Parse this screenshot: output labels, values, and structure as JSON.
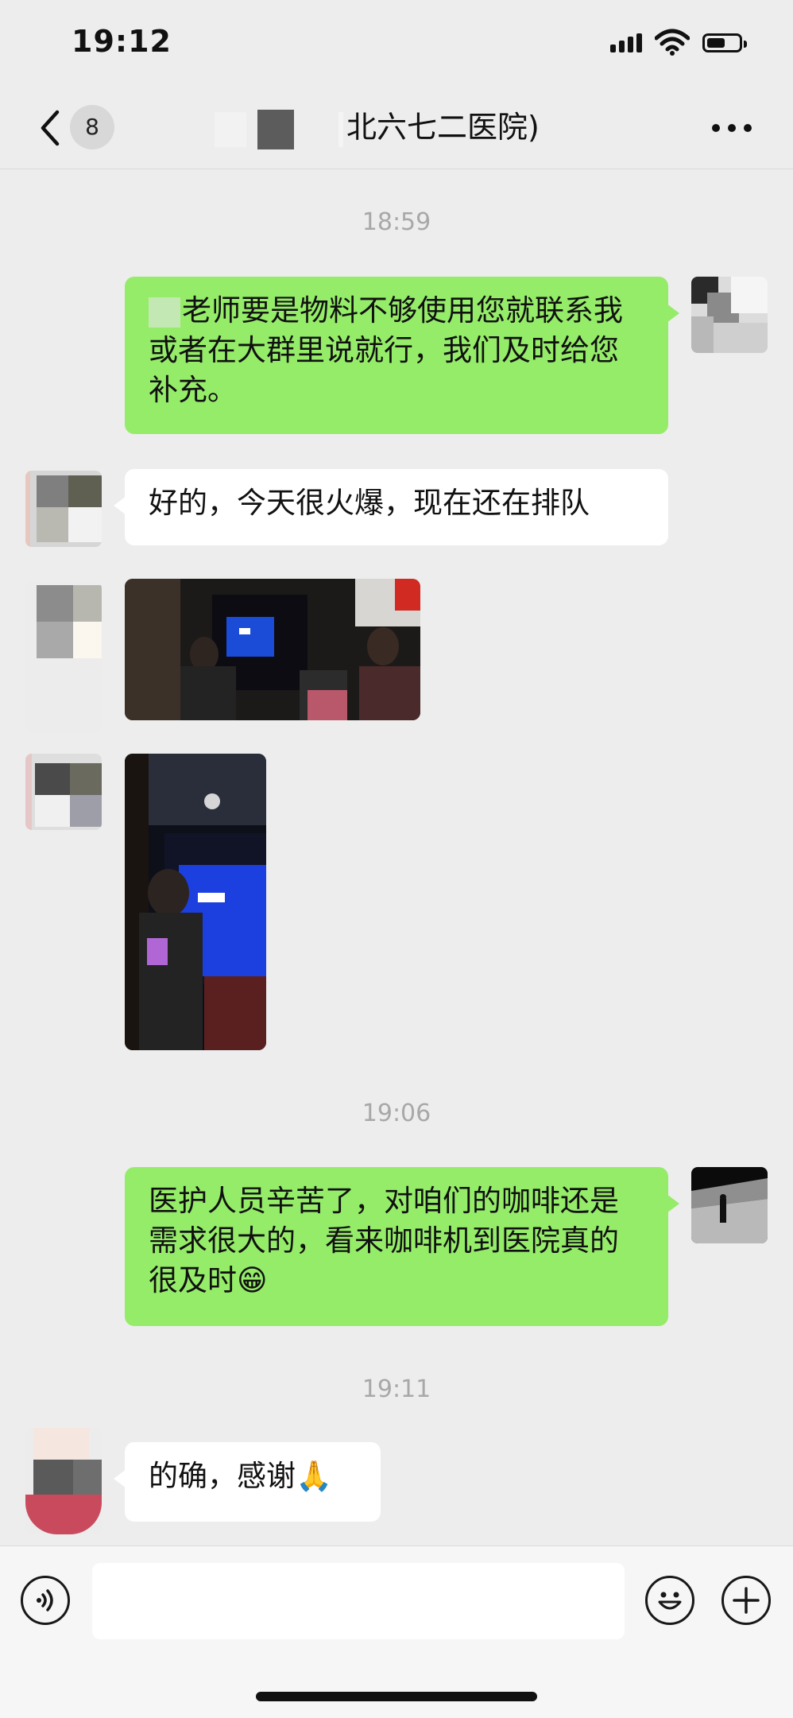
{
  "status_bar": {
    "time": "19:12"
  },
  "nav": {
    "unread_count": "8",
    "title": "北六七二医院)"
  },
  "messages": {
    "ts1": "18:59",
    "m1_text": "老师要是物料不够使用您就联系我或者在大群里说就行，我们及时给您补充。",
    "m2_text": "好的，今天很火爆，现在还在排队",
    "ts2": "19:06",
    "m3_text": "医护人员辛苦了，对咱们的咖啡还是需求很大的，看来咖啡机到医院真的很及时😁",
    "ts3": "19:11",
    "m4_text": "的确，感谢🙏"
  },
  "icons": {
    "back": "chevron-left-icon",
    "more": "more-horizontal-icon",
    "voice": "voice-icon",
    "emoji": "emoji-icon",
    "add": "plus-icon"
  },
  "colors": {
    "background": "#ededed",
    "my_bubble": "#95ec69",
    "their_bubble": "#ffffff",
    "timestamp": "#a8a8a8"
  }
}
